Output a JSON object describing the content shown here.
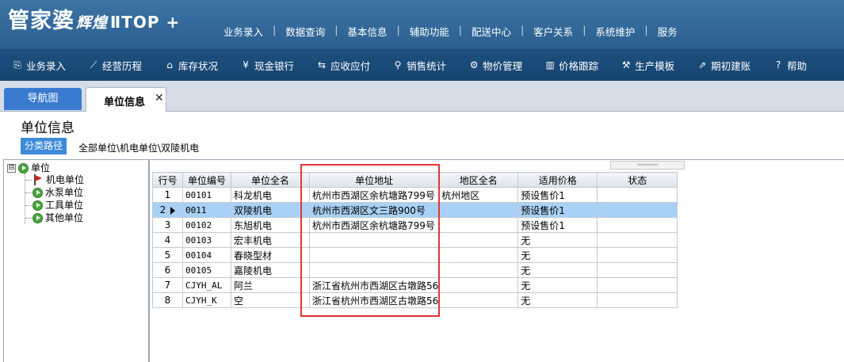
{
  "app": {
    "logo": "管家婆",
    "logo_sub": "辉煌",
    "logo_ver": "ⅡTOP +",
    "top_menu": [
      "业务录入",
      "数据查询",
      "基本信息",
      "辅助功能",
      "配送中心",
      "客户关系",
      "系统维护",
      "服务"
    ]
  },
  "toolbar": [
    {
      "icon": "document-icon",
      "glyph": "⎘",
      "label": "业务录入"
    },
    {
      "icon": "line-chart-icon",
      "glyph": "⟋",
      "label": "经营历程"
    },
    {
      "icon": "warehouse-icon",
      "glyph": "⌂",
      "label": "库存状况"
    },
    {
      "icon": "yen-icon",
      "glyph": "¥",
      "label": "现金银行"
    },
    {
      "icon": "exchange-icon",
      "glyph": "⇆",
      "label": "应收应付"
    },
    {
      "icon": "search-icon",
      "glyph": "⚲",
      "label": "销售统计"
    },
    {
      "icon": "gear-icon",
      "glyph": "⚙",
      "label": "物价管理"
    },
    {
      "icon": "bar-chart-icon",
      "glyph": "▥",
      "label": "价格跟踪"
    },
    {
      "icon": "wrench-icon",
      "glyph": "⚒",
      "label": "生产模板"
    },
    {
      "icon": "external-link-icon",
      "glyph": "⇗",
      "label": "期初建账"
    },
    {
      "icon": "help-icon",
      "glyph": "?",
      "label": "帮助"
    }
  ],
  "tabs": {
    "nav": "导航图",
    "active": "单位信息",
    "close_glyph": "✕"
  },
  "page": {
    "title": "单位信息",
    "path_button": "分类路径",
    "path": "全部单位\\机电单位\\双陵机电"
  },
  "tree": {
    "expander": "⊟",
    "root": "单位",
    "children": [
      "机电单位",
      "水泵单位",
      "工具单位",
      "其他单位"
    ]
  },
  "scroll_hint": "»»»»»»»»",
  "grid": {
    "columns": [
      "行号",
      "单位编号",
      "单位全名",
      "单位地址",
      "地区全名",
      "适用价格",
      "状态"
    ],
    "rows": [
      {
        "no": "1",
        "code": "00101",
        "name": "科龙机电",
        "address": "杭州市西湖区余杭塘路799号",
        "region": "杭州地区",
        "price": "预设售价1",
        "status": ""
      },
      {
        "no": "2",
        "code": "0011",
        "name": "双陵机电",
        "address": "杭州市西湖区文三路900号",
        "region": "",
        "price": "预设售价1",
        "status": ""
      },
      {
        "no": "3",
        "code": "00102",
        "name": "东旭机电",
        "address": "杭州市西湖区余杭塘路799号",
        "region": "",
        "price": "预设售价1",
        "status": ""
      },
      {
        "no": "4",
        "code": "00103",
        "name": "宏丰机电",
        "address": "",
        "region": "",
        "price": "无",
        "status": ""
      },
      {
        "no": "5",
        "code": "00104",
        "name": "春晓型材",
        "address": "",
        "region": "",
        "price": "无",
        "status": ""
      },
      {
        "no": "6",
        "code": "00105",
        "name": "嘉陵机电",
        "address": "",
        "region": "",
        "price": "无",
        "status": ""
      },
      {
        "no": "7",
        "code": "CJYH_AL",
        "name": "阿兰",
        "address": "浙江省杭州市西湖区古墩路56",
        "region": "",
        "price": "无",
        "status": ""
      },
      {
        "no": "8",
        "code": "CJYH_K",
        "name": "空",
        "address": "浙江省杭州市西湖区古墩路56",
        "region": "",
        "price": "无",
        "status": ""
      }
    ],
    "selected_row": 1
  },
  "colors": {
    "banner": "#2c5f8f",
    "toolbar": "#174571",
    "selection": "#a9d1f5",
    "highlight_box": "#e53535"
  }
}
